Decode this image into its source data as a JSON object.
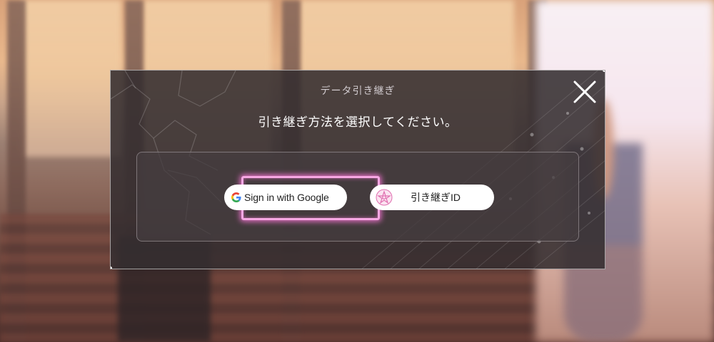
{
  "dialog": {
    "title": "データ引き継ぎ",
    "prompt": "引き継ぎ方法を選択してください。",
    "close_icon": "close-icon"
  },
  "buttons": {
    "google": {
      "label": "Sign in with Google",
      "icon": "google-g-icon",
      "highlighted": true
    },
    "transfer_id": {
      "label": "引き継ぎID",
      "icon": "flower-emblem-icon"
    }
  },
  "colors": {
    "dialog_bg": "#342e30",
    "highlight": "#f7a8e4",
    "emblem": "#e06fb0"
  }
}
